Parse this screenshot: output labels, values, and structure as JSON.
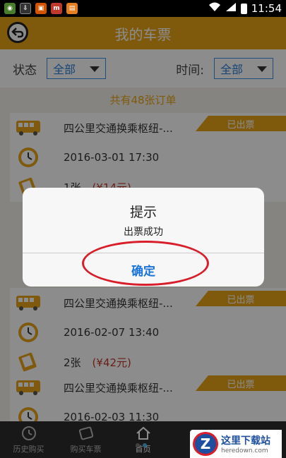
{
  "status_bar": {
    "time": "11:54"
  },
  "header": {
    "title": "我的车票"
  },
  "filters": {
    "status_label": "状态",
    "status_value": "全部",
    "time_label": "时间:",
    "time_value": "全部"
  },
  "summary": {
    "count_text": "共有48张订单"
  },
  "tickets": [
    {
      "route": "四公里交通换乘枢纽-...",
      "badge": "已出票",
      "datetime": "2016-03-01 17:30",
      "qty": "1张",
      "price": "(¥14元)"
    },
    {
      "route": "四公里交通换乘枢纽-...",
      "badge": "已出票",
      "datetime": "2016-02-07 13:40",
      "qty": "2张",
      "price": "(¥42元)"
    },
    {
      "route": "四公里交通换乘枢纽-...",
      "badge": "已出票",
      "datetime": "2016-02-03 11:30"
    }
  ],
  "bottom_nav": {
    "items": [
      {
        "label": "历史购买"
      },
      {
        "label": "购买车票"
      },
      {
        "label": "首页"
      }
    ]
  },
  "dialog": {
    "title": "提示",
    "message": "出票成功",
    "confirm_label": "确定"
  },
  "watermark": {
    "brand": "这里下载站",
    "site": "heredown.com"
  },
  "colors": {
    "accent": "#e8a417",
    "link": "#1a73d9",
    "highlight": "#d81e2a"
  }
}
